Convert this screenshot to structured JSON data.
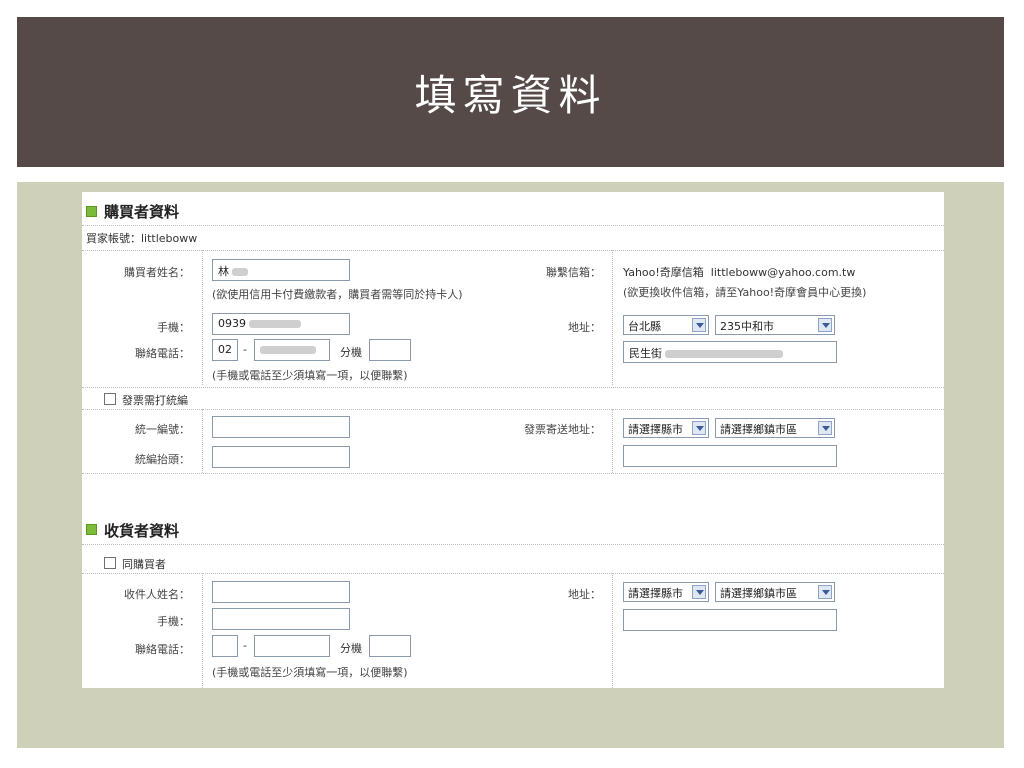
{
  "slide": {
    "title": "填寫資料"
  },
  "buyer": {
    "section_title": "購買者資料",
    "account_line": "買家帳號：littleboww",
    "name_label": "購買者姓名：",
    "name_value": "林",
    "name_note": "(欲使用信用卡付費繳款者，購買者需等同於持卡人)",
    "mobile_label": "手機：",
    "mobile_value": "0939",
    "phone_label": "聯絡電話：",
    "phone_area": "02",
    "dash": "-",
    "ext_label": "分機",
    "phone_note": "(手機或電話至少須填寫一項，以便聯繫)",
    "email_label": "聯繫信箱：",
    "email_provider": "Yahoo!奇摩信箱",
    "email_value": "littleboww@yahoo.com.tw",
    "email_note": "(欲更換收件信箱，請至Yahoo!奇摩會員中心更換)",
    "address_label": "地址：",
    "county_value": "台北縣",
    "district_value": "235中和市",
    "street_value": "民生街"
  },
  "invoice": {
    "checkbox_label": "發票需打統編",
    "tax_id_label": "統一編號：",
    "title_label": "統編抬頭：",
    "mail_address_label": "發票寄送地址：",
    "county_placeholder": "請選擇縣市",
    "district_placeholder": "請選擇鄉鎮市區"
  },
  "receiver": {
    "section_title": "收貨者資料",
    "same_as_buyer_label": "同購買者",
    "name_label": "收件人姓名：",
    "mobile_label": "手機：",
    "phone_label": "聯絡電話：",
    "dash": "-",
    "ext_label": "分機",
    "phone_note": "(手機或電話至少須填寫一項，以便聯繫)",
    "address_label": "地址：",
    "county_placeholder": "請選擇縣市",
    "district_placeholder": "請選擇鄉鎮市區"
  }
}
